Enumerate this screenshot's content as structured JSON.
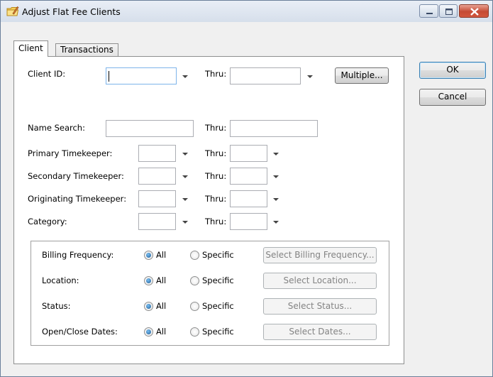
{
  "window": {
    "title": "Adjust Flat Fee Clients"
  },
  "tabs": [
    {
      "label": "Client",
      "active": true
    },
    {
      "label": "Transactions",
      "active": false
    }
  ],
  "client": {
    "client_id_label": "Client ID:",
    "client_id_value": "",
    "thru_label": "Thru:",
    "client_id_thru_value": "",
    "multiple_button": "Multiple...",
    "name_search_label": "Name Search:",
    "name_search_value": "",
    "name_search_thru_value": "",
    "primary_tk_label": "Primary Timekeeper:",
    "secondary_tk_label": "Secondary Timekeeper:",
    "originating_tk_label": "Originating Timekeeper:",
    "category_label": "Category:"
  },
  "filters": [
    {
      "label": "Billing Frequency:",
      "all": "All",
      "specific": "Specific",
      "selected": "All",
      "button": "Select Billing Frequency..."
    },
    {
      "label": "Location:",
      "all": "All",
      "specific": "Specific",
      "selected": "All",
      "button": "Select Location..."
    },
    {
      "label": "Status:",
      "all": "All",
      "specific": "Specific",
      "selected": "All",
      "button": "Select Status..."
    },
    {
      "label": "Open/Close Dates:",
      "all": "All",
      "specific": "Specific",
      "selected": "All",
      "button": "Select Dates..."
    }
  ],
  "actions": {
    "ok": "OK",
    "cancel": "Cancel"
  },
  "icons": {
    "title": "folder-pencil-icon",
    "minimize": "minimize-icon",
    "maximize": "maximize-icon",
    "close": "close-icon",
    "dropdown": "chevron-down-icon"
  }
}
